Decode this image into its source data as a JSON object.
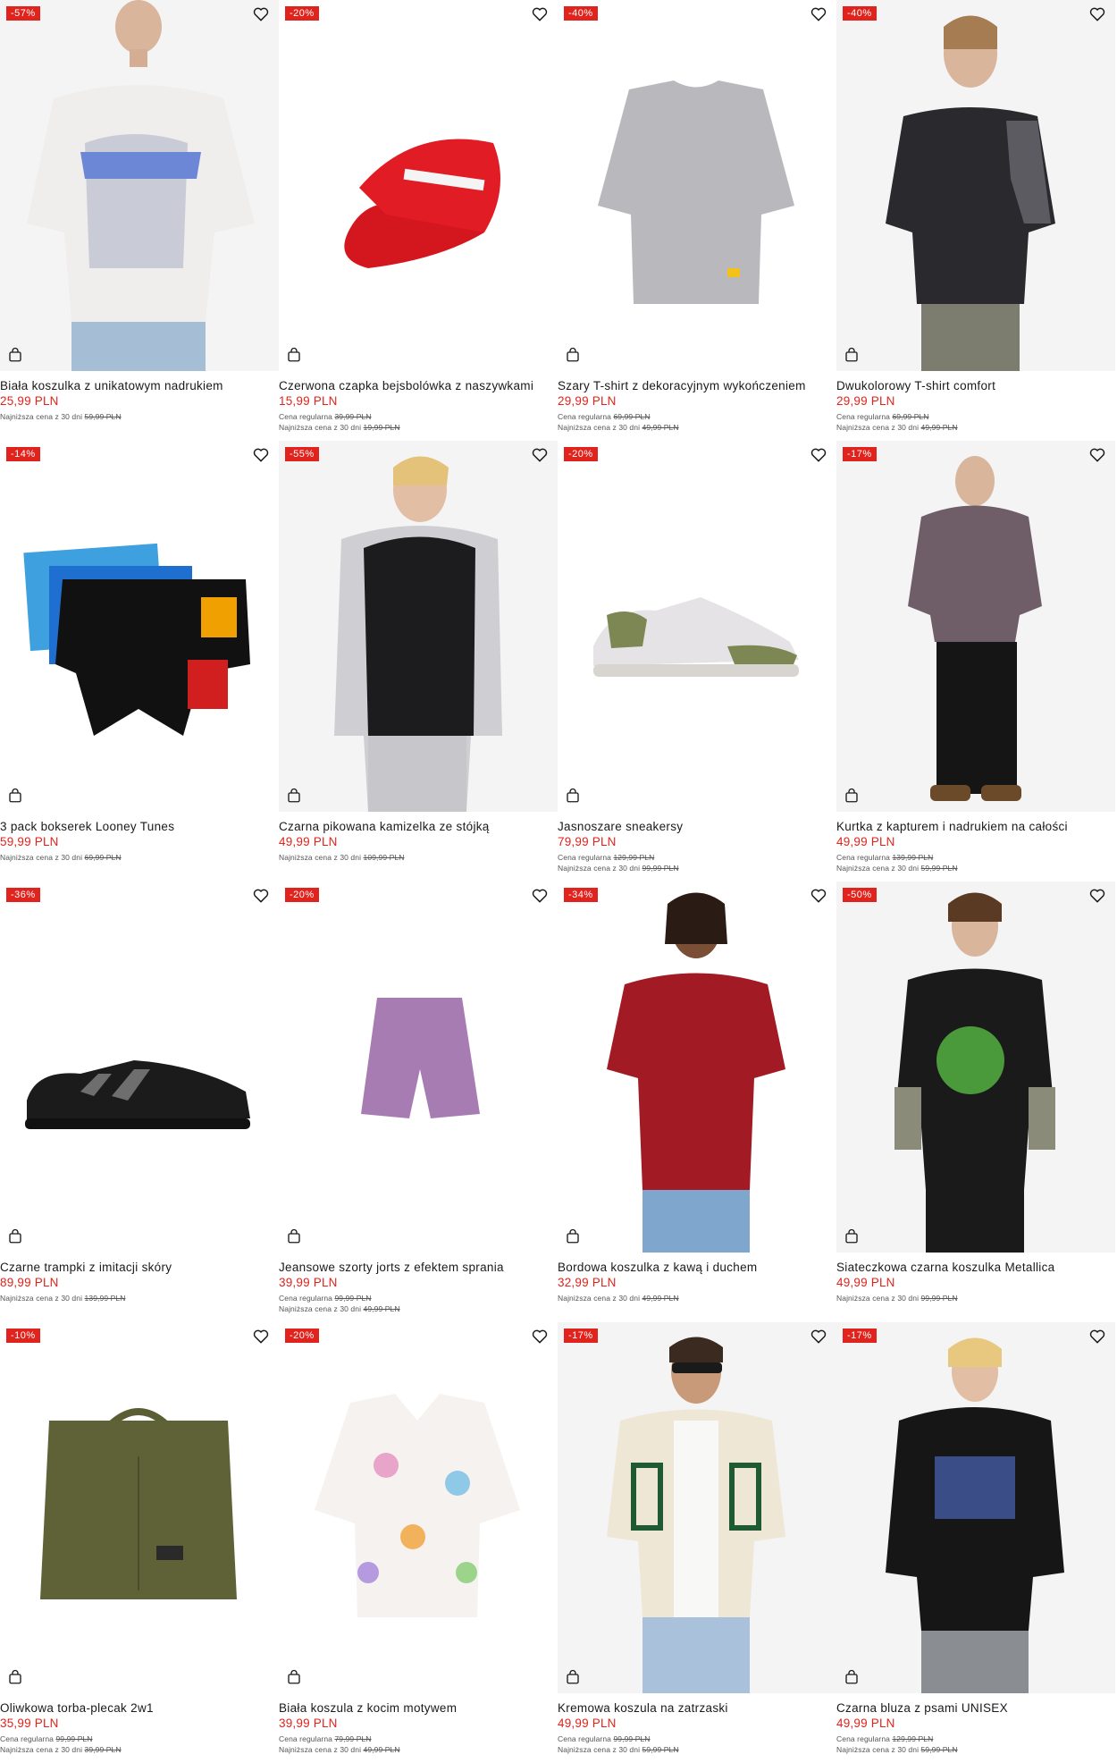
{
  "colors": {
    "accent": "#e0231c",
    "text": "#1a1a1a",
    "muted": "#555555"
  },
  "icons": {
    "wishlist": "heart-icon",
    "cart": "shopping-bag-icon"
  },
  "products": [
    {
      "discount": "-57%",
      "title": "Biała koszulka z unikatowym nadrukiem",
      "price": "25,99 PLN",
      "regular": "",
      "lowest_label": "Najniższa cena z 30 dni",
      "lowest": "59,99 PLN"
    },
    {
      "discount": "-20%",
      "title": "Czerwona czapka bejsbolówka z naszywkami",
      "price": "15,99 PLN",
      "regular_label": "Cena regularna",
      "regular": "39,99 PLN",
      "lowest_label": "Najniższa cena z 30 dni",
      "lowest": "19,99 PLN"
    },
    {
      "discount": "-40%",
      "title": "Szary T-shirt z dekoracyjnym wykończeniem",
      "price": "29,99 PLN",
      "regular_label": "Cena regularna",
      "regular": "69,99 PLN",
      "lowest_label": "Najniższa cena z 30 dni",
      "lowest": "49,99 PLN"
    },
    {
      "discount": "-40%",
      "title": "Dwukolorowy T-shirt comfort",
      "price": "29,99 PLN",
      "regular_label": "Cena regularna",
      "regular": "69,99 PLN",
      "lowest_label": "Najniższa cena z 30 dni",
      "lowest": "49,99 PLN"
    },
    {
      "discount": "-14%",
      "title": "3 pack bokserek Looney Tunes",
      "price": "59,99 PLN",
      "regular": "",
      "lowest_label": "Najniższa cena z 30 dni",
      "lowest": "69,99 PLN"
    },
    {
      "discount": "-55%",
      "title": "Czarna pikowana kamizelka ze stójką",
      "price": "49,99 PLN",
      "regular": "",
      "lowest_label": "Najniższa cena z 30 dni",
      "lowest": "109,99 PLN"
    },
    {
      "discount": "-20%",
      "title": "Jasnoszare sneakersy",
      "price": "79,99 PLN",
      "regular_label": "Cena regularna",
      "regular": "129,99 PLN",
      "lowest_label": "Najniższa cena z 30 dni",
      "lowest": "99,99 PLN"
    },
    {
      "discount": "-17%",
      "title": "Kurtka z kapturem i nadrukiem na całości",
      "price": "49,99 PLN",
      "regular_label": "Cena regularna",
      "regular": "139,99 PLN",
      "lowest_label": "Najniższa cena z 30 dni",
      "lowest": "59,99 PLN"
    },
    {
      "discount": "-36%",
      "title": "Czarne trampki z imitacji skóry",
      "price": "89,99 PLN",
      "regular": "",
      "lowest_label": "Najniższa cena z 30 dni",
      "lowest": "139,99 PLN"
    },
    {
      "discount": "-20%",
      "title": "Jeansowe szorty jorts z efektem sprania",
      "price": "39,99 PLN",
      "regular_label": "Cena regularna",
      "regular": "99,99 PLN",
      "lowest_label": "Najniższa cena z 30 dni",
      "lowest": "49,99 PLN"
    },
    {
      "discount": "-34%",
      "title": "Bordowa koszulka z kawą i duchem",
      "price": "32,99 PLN",
      "regular": "",
      "lowest_label": "Najniższa cena z 30 dni",
      "lowest": "49,99 PLN"
    },
    {
      "discount": "-50%",
      "title": "Siateczkowa czarna koszulka Metallica",
      "price": "49,99 PLN",
      "regular": "",
      "lowest_label": "Najniższa cena z 30 dni",
      "lowest": "99,99 PLN"
    },
    {
      "discount": "-10%",
      "title": "Oliwkowa torba-plecak 2w1",
      "price": "35,99 PLN",
      "regular_label": "Cena regularna",
      "regular": "99,99 PLN",
      "lowest_label": "Najniższa cena z 30 dni",
      "lowest": "39,99 PLN"
    },
    {
      "discount": "-20%",
      "title": "Biała koszula z kocim motywem",
      "price": "39,99 PLN",
      "regular_label": "Cena regularna",
      "regular": "79,99 PLN",
      "lowest_label": "Najniższa cena z 30 dni",
      "lowest": "49,99 PLN"
    },
    {
      "discount": "-17%",
      "title": "Kremowa koszula na zatrzaski",
      "price": "49,99 PLN",
      "regular_label": "Cena regularna",
      "regular": "99,99 PLN",
      "lowest_label": "Najniższa cena z 30 dni",
      "lowest": "59,99 PLN"
    },
    {
      "discount": "-17%",
      "title": "Czarna bluza z psami UNISEX",
      "price": "49,99 PLN",
      "regular_label": "Cena regularna",
      "regular": "129,99 PLN",
      "lowest_label": "Najniższa cena z 30 dni",
      "lowest": "59,99 PLN"
    }
  ]
}
